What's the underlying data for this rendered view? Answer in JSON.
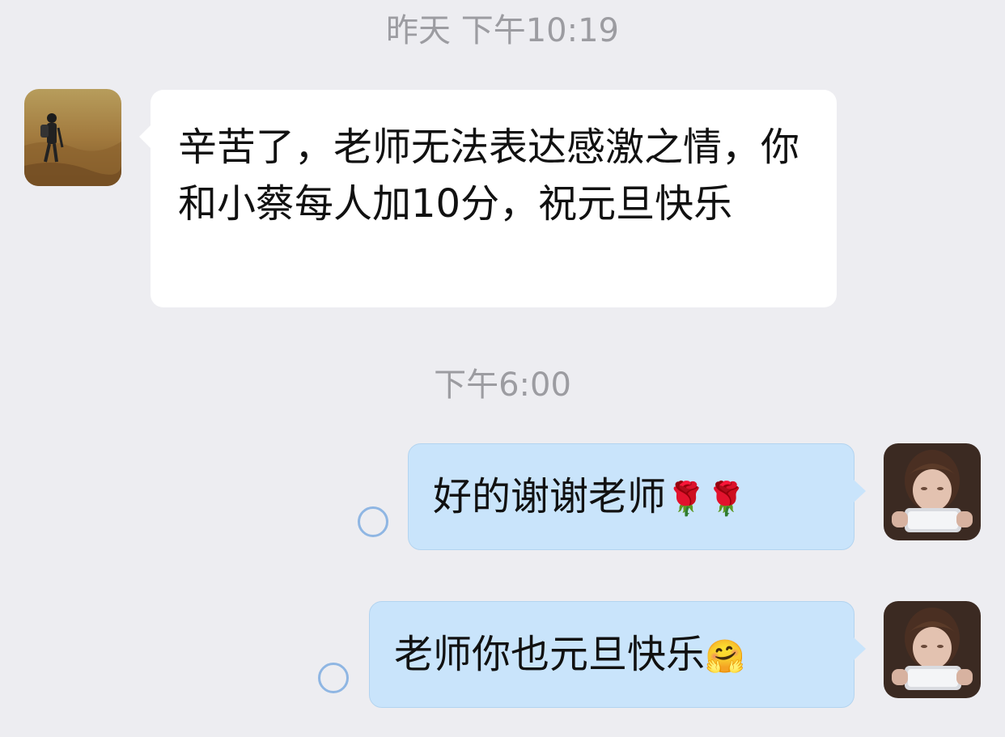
{
  "timestamps": {
    "first": "昨天 下午10:19",
    "second": "下午6:00"
  },
  "messages": [
    {
      "direction": "incoming",
      "text": "辛苦了，老师无法表达感激之情，你和小蔡每人加10分，祝元旦快乐",
      "avatar_icon": "hiker-photo-avatar"
    },
    {
      "direction": "outgoing",
      "text": "好的谢谢老师",
      "emoji": "🌹🌹",
      "avatar_icon": "girl-photo-avatar",
      "status_icon": "sending-circle-icon"
    },
    {
      "direction": "outgoing",
      "text": "老师你也元旦快乐",
      "emoji": "🤗",
      "avatar_icon": "girl-photo-avatar",
      "status_icon": "sending-circle-icon"
    }
  ],
  "colors": {
    "background": "#ededf1",
    "incoming_bubble": "#ffffff",
    "outgoing_bubble": "#c9e4fb",
    "timestamp_text": "#9c9ca1",
    "status_circle": "#8fb6e3"
  }
}
